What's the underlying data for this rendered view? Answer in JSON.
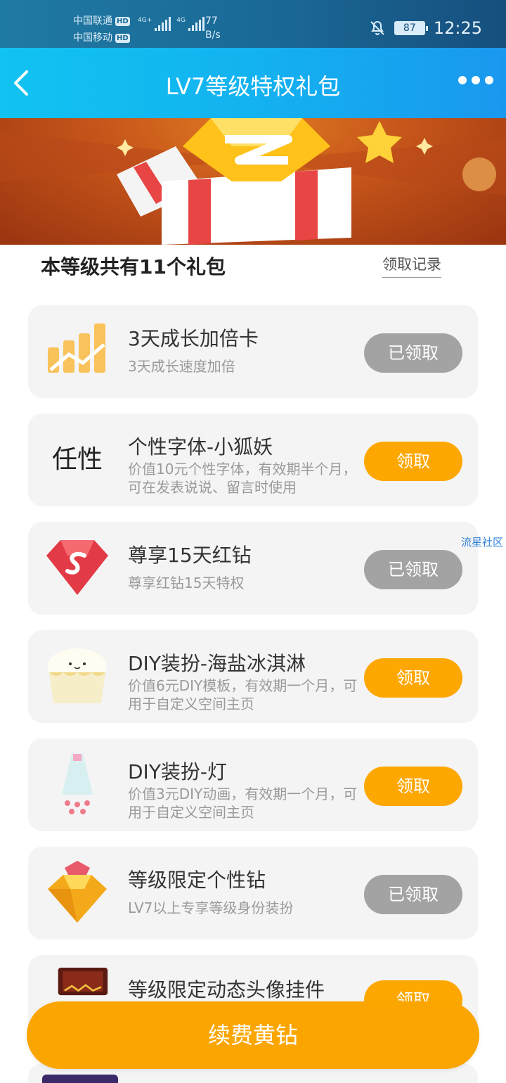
{
  "status_bar": {
    "carrier_1": "中国联通",
    "carrier_2": "中国移动",
    "hd_badge": "HD",
    "net_1": "4G+",
    "net_2": "4G",
    "net_speed_value": "77",
    "net_speed_unit": "B/s",
    "battery": "87",
    "time": "12:25"
  },
  "nav": {
    "title": "LV7等级特权礼包"
  },
  "section": {
    "title": "本等级共有11个礼包",
    "record_link": "领取记录"
  },
  "gifts": [
    {
      "name": "3天成长加倍卡",
      "desc": "3天成长速度加倍",
      "button": "已领取",
      "state": "claimed",
      "icon": "growth-chart-icon"
    },
    {
      "name": "个性字体-小狐妖",
      "desc": "价值10元个性字体，有效期半个月，可在发表说说、留言时使用",
      "button": "领取",
      "state": "claim",
      "icon": "font-sample-icon",
      "font_sample": "任性"
    },
    {
      "name": "尊享15天红钻",
      "desc": "尊享红钻15天特权",
      "button": "已领取",
      "state": "claimed",
      "icon": "red-diamond-icon"
    },
    {
      "name": "DIY装扮-海盐冰淇淋",
      "desc": "价值6元DIY模板，有效期一个月，可用于自定义空间主页",
      "button": "领取",
      "state": "claim",
      "icon": "ice-cream-icon"
    },
    {
      "name": "DIY装扮-灯",
      "desc": "价值3元DIY动画，有效期一个月，可用于自定义空间主页",
      "button": "领取",
      "state": "claim",
      "icon": "lamp-icon"
    },
    {
      "name": "等级限定个性钻",
      "desc": "LV7以上专享等级身份装扮",
      "button": "已领取",
      "state": "claimed",
      "icon": "yellow-diamond-icon"
    },
    {
      "name": "等级限定动态头像挂件",
      "desc": "",
      "button": "领取",
      "state": "claim",
      "icon": "avatar-frame-icon"
    }
  ],
  "watermark": "流星社区",
  "renew_button": "续费黄钻",
  "colors": {
    "claim": "#fda700",
    "claimed": "#a3a3a3",
    "nav": "#13b2f0"
  }
}
